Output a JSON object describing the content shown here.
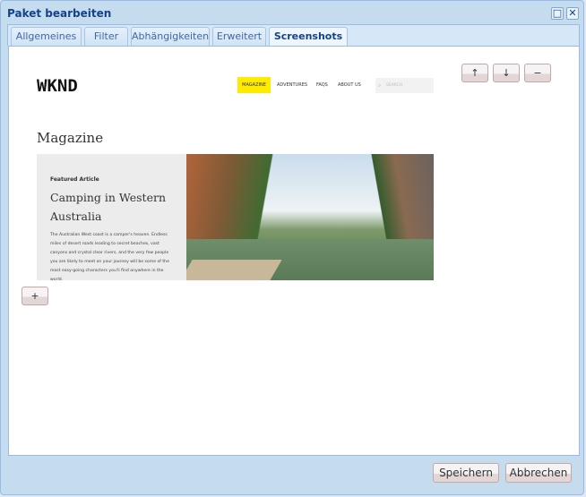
{
  "window": {
    "title": "Paket bearbeiten"
  },
  "tabs": [
    "Allgemeines",
    "Filter",
    "Abhängigkeiten",
    "Erweitert",
    "Screenshots"
  ],
  "screenshot": {
    "logo": "WKND",
    "nav": [
      "MAGAZINE",
      "ADVENTURES",
      "FAQS",
      "ABOUT US"
    ],
    "search_placeholder": "SEARCH",
    "heading": "Magazine",
    "featured_label": "Featured Article",
    "featured_title": "Camping in Western Australia",
    "featured_text": "The Australian West coast is a camper's heaven. Endless miles of desert roads leading to secret beaches, vast canyons and crystal clear rivers, and the very few people you are likely to meet on your journey will be some of the most easy-going characters you'll find anywhere in the world."
  },
  "controls": {
    "up": "↑",
    "down": "↓",
    "remove": "−",
    "add": "+"
  },
  "footer": {
    "save": "Speichern",
    "cancel": "Abbrechen"
  }
}
